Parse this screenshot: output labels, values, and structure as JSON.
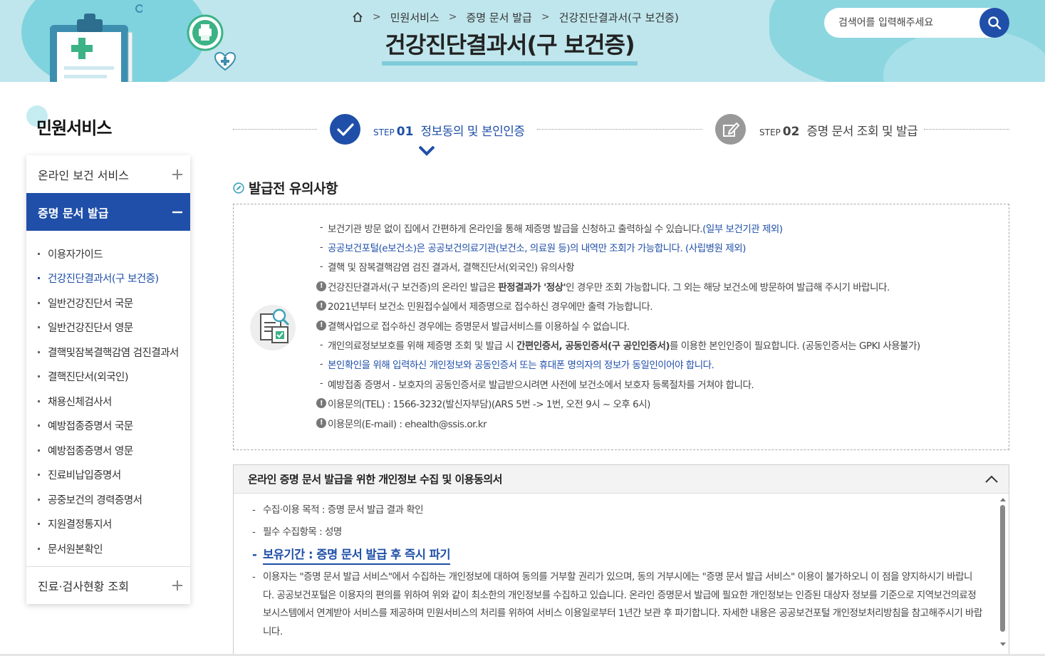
{
  "header": {
    "breadcrumb": [
      "민원서비스",
      "증명 문서 발급",
      "건강진단결과서(구 보건증)"
    ],
    "page_title": "건강진단결과서(구 보건증)",
    "search_placeholder": "검색어를 입력해주세요"
  },
  "sidebar": {
    "title": "민원서비스",
    "menu_top": "온라인 보건 서비스",
    "menu_active": "증명 문서 발급",
    "sub_items": [
      {
        "label": "이용자가이드",
        "active": false
      },
      {
        "label": "건강진단결과서(구 보건증)",
        "active": true
      },
      {
        "label": "일반건강진단서 국문",
        "active": false
      },
      {
        "label": "일반건강진단서 영문",
        "active": false
      },
      {
        "label": "결핵및잠복결핵감염 검진결과서",
        "active": false
      },
      {
        "label": "결핵진단서(외국인)",
        "active": false
      },
      {
        "label": "채용신체검사서",
        "active": false
      },
      {
        "label": "예방접종증명서 국문",
        "active": false
      },
      {
        "label": "예방접종증명서 영문",
        "active": false
      },
      {
        "label": "진료비납입증명서",
        "active": false
      },
      {
        "label": "공중보건의 경력증명서",
        "active": false
      },
      {
        "label": "지원결정통지서",
        "active": false
      },
      {
        "label": "문서원본확인",
        "active": false
      }
    ],
    "menu_bottom": "진료·검사현황 조회"
  },
  "steps": [
    {
      "step": "STEP",
      "num": "01",
      "label": "정보동의 및 본인인증",
      "active": true
    },
    {
      "step": "STEP",
      "num": "02",
      "label": "증명 문서 조회 및 발급",
      "active": false
    }
  ],
  "notice": {
    "heading": "발급전 유의사항",
    "items": [
      {
        "type": "dash",
        "parts": [
          {
            "t": "보건기관 방문 없이 집에서 간편하게 온라인을 통해 제증명 발급을 신청하고 출력하실 수 있습니다."
          },
          {
            "t": "(일부 보건기관 제외)",
            "c": "blue"
          }
        ]
      },
      {
        "type": "dash",
        "parts": [
          {
            "t": "공공보건포털(e보건소)은 공공보건의료기관(보건소, 의료원 등)의 내역만 조회가 가능합니다. (사립병원 제외)",
            "c": "blue"
          }
        ]
      },
      {
        "type": "dash",
        "parts": [
          {
            "t": "결핵 및 잠복결핵감염 검진 결과서, 결핵진단서(외국인) 유의사항"
          }
        ]
      },
      {
        "type": "bang",
        "parts": [
          {
            "t": "건강진단결과서(구 보건증)의 온라인 발급은 "
          },
          {
            "t": "판정결과가 '정상'",
            "c": "bold"
          },
          {
            "t": "인 경우만 조회 가능합니다. 그 외는 해당 보건소에 방문하여 발급해 주시기 바랍니다."
          }
        ]
      },
      {
        "type": "bang",
        "parts": [
          {
            "t": "2021년부터 보건소 민원접수실에서 제증명으로 접수하신 경우에만 출력 가능합니다."
          }
        ]
      },
      {
        "type": "bang",
        "parts": [
          {
            "t": "결핵사업으로 접수하신 경우에는 증명문서 발급서비스를 이용하실 수 없습니다."
          }
        ]
      },
      {
        "type": "dash",
        "parts": [
          {
            "t": "개인의료정보보호를 위해 제증명 조회 및 발급 시 "
          },
          {
            "t": "간편인증서, 공동인증서(구 공인인증서)",
            "c": "bold"
          },
          {
            "t": "를 이용한 본인인증이 필요합니다. (공동인증서는 GPKI 사용불가)"
          }
        ]
      },
      {
        "type": "dash",
        "parts": [
          {
            "t": "본인확인을 위해 입력하신 개인정보와 공동인증서 또는 휴대폰 명의자의 정보가 동일인이어야 합니다.",
            "c": "blue"
          }
        ]
      },
      {
        "type": "dash",
        "parts": [
          {
            "t": "예방접종 증명서 - 보호자의 공동인증서로 발급받으시려면 사전에 보건소에서 보호자 등록절차를 거쳐야 합니다."
          }
        ]
      },
      {
        "type": "bang",
        "parts": [
          {
            "t": "이용문의(TEL) : 1566-3232(발신자부담)(ARS 5번 -> 1번, 오전 9시 ~ 오후 6시)"
          }
        ]
      },
      {
        "type": "bang",
        "parts": [
          {
            "t": "이용문의(E-mail) : ehealth@ssis.or.kr"
          }
        ]
      }
    ]
  },
  "consent": {
    "title": "온라인 증명 문서 발급을 위한 개인정보 수집 및 이용동의서",
    "items": [
      {
        "text": "수집·이용 목적 : 증명 문서 발급 결과 확인",
        "highlight": false
      },
      {
        "text": "필수 수집항목 : 성명",
        "highlight": false
      },
      {
        "text": "보유기간 : 증명 문서 발급 후 즉시 파기",
        "highlight": true
      },
      {
        "text": "이용자는 \"증명 문서 발급 서비스\"에서 수집하는 개인정보에 대하여 동의를 거부할 권리가 있으며, 동의 거부시에는 \"증명 문서 발급 서비스\" 이용이 불가하오니 이 점을 양지하시기 바랍니다. 공공보건포털은 이용자의 편의를 위하여 위와 같이 최소한의 개인정보를 수집하고 있습니다. 온라인 증명문서 발급에 필요한 개인정보는 인증된 대상자 정보를 기준으로 지역보건의료정보시스템에서 연계받아 서비스를 제공하며 민원서비스의 처리를 위하여 서비스 이용일로부터 1년간 보관 후 파기합니다. 자세한 내용은 공공보건포털 개인정보처리방침을 참고해주시기 바랍니다.",
        "highlight": false
      }
    ]
  },
  "colors": {
    "primary": "#1f4fa8",
    "header_bg": "#bfe6ec",
    "inactive_step": "#999999"
  }
}
